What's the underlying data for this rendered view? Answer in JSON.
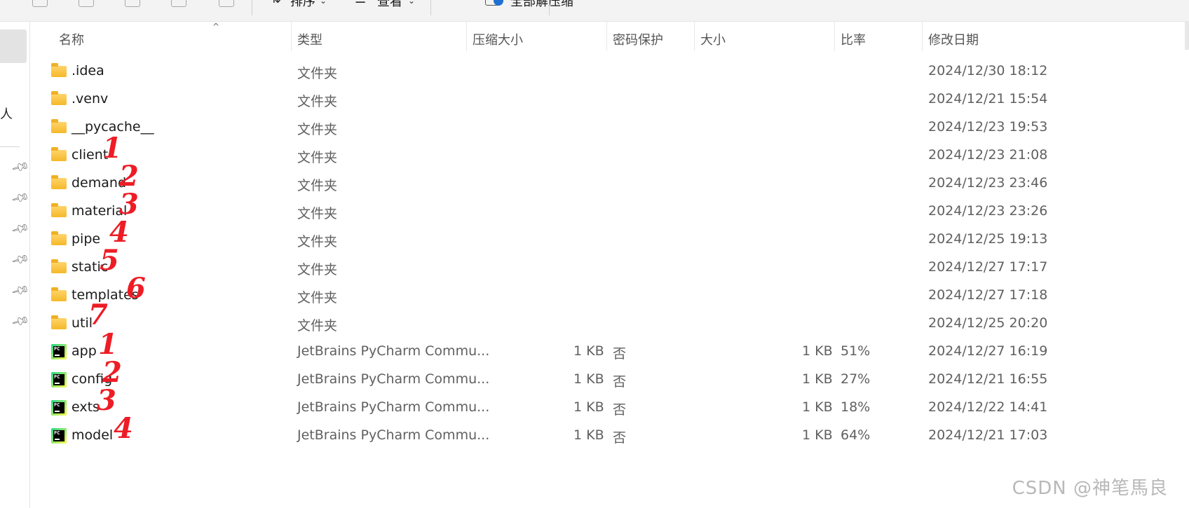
{
  "toolbar": {
    "sort_label": "排序",
    "view_label": "查看",
    "extract_all_label": "全部解压缩",
    "more_label": "⋯"
  },
  "nav": {
    "partial_glyph": "人"
  },
  "columns": {
    "name": "名称",
    "type": "类型",
    "compressed_size": "压缩大小",
    "password": "密码保护",
    "size": "大小",
    "ratio": "比率",
    "modified": "修改日期"
  },
  "rows": [
    {
      "name": ".idea",
      "type": "文件夹",
      "compressed": "",
      "password": "",
      "size": "",
      "ratio": "",
      "modified": "2024/12/30 18:12",
      "icon": "folder-icon"
    },
    {
      "name": ".venv",
      "type": "文件夹",
      "compressed": "",
      "password": "",
      "size": "",
      "ratio": "",
      "modified": "2024/12/21 15:54",
      "icon": "folder-icon"
    },
    {
      "name": "__pycache__",
      "type": "文件夹",
      "compressed": "",
      "password": "",
      "size": "",
      "ratio": "",
      "modified": "2024/12/23 19:53",
      "icon": "folder-icon"
    },
    {
      "name": "client",
      "type": "文件夹",
      "compressed": "",
      "password": "",
      "size": "",
      "ratio": "",
      "modified": "2024/12/23 21:08",
      "icon": "folder-icon",
      "annotation": "1"
    },
    {
      "name": "demand",
      "type": "文件夹",
      "compressed": "",
      "password": "",
      "size": "",
      "ratio": "",
      "modified": "2024/12/23 23:46",
      "icon": "folder-icon",
      "annotation": "2"
    },
    {
      "name": "material",
      "type": "文件夹",
      "compressed": "",
      "password": "",
      "size": "",
      "ratio": "",
      "modified": "2024/12/23 23:26",
      "icon": "folder-icon",
      "annotation": "3"
    },
    {
      "name": "pipe",
      "type": "文件夹",
      "compressed": "",
      "password": "",
      "size": "",
      "ratio": "",
      "modified": "2024/12/25 19:13",
      "icon": "folder-icon",
      "annotation": "4"
    },
    {
      "name": "static",
      "type": "文件夹",
      "compressed": "",
      "password": "",
      "size": "",
      "ratio": "",
      "modified": "2024/12/27 17:17",
      "icon": "folder-icon",
      "annotation": "5"
    },
    {
      "name": "templates",
      "type": "文件夹",
      "compressed": "",
      "password": "",
      "size": "",
      "ratio": "",
      "modified": "2024/12/27 17:18",
      "icon": "folder-icon",
      "annotation": "6"
    },
    {
      "name": "util",
      "type": "文件夹",
      "compressed": "",
      "password": "",
      "size": "",
      "ratio": "",
      "modified": "2024/12/25 20:20",
      "icon": "folder-icon",
      "annotation": "7"
    },
    {
      "name": "app",
      "type": "JetBrains PyCharm Commu...",
      "compressed": "1 KB",
      "password": "否",
      "size": "1 KB",
      "ratio": "51%",
      "modified": "2024/12/27 16:19",
      "icon": "pycharm-icon",
      "annotation": "1"
    },
    {
      "name": "config",
      "type": "JetBrains PyCharm Commu...",
      "compressed": "1 KB",
      "password": "否",
      "size": "1 KB",
      "ratio": "27%",
      "modified": "2024/12/21 16:55",
      "icon": "pycharm-icon",
      "annotation": "2"
    },
    {
      "name": "exts",
      "type": "JetBrains PyCharm Commu...",
      "compressed": "1 KB",
      "password": "否",
      "size": "1 KB",
      "ratio": "18%",
      "modified": "2024/12/22 14:41",
      "icon": "pycharm-icon",
      "annotation": "3"
    },
    {
      "name": "model",
      "type": "JetBrains PyCharm Commu...",
      "compressed": "1 KB",
      "password": "否",
      "size": "1 KB",
      "ratio": "64%",
      "modified": "2024/12/21 17:03",
      "icon": "pycharm-icon",
      "annotation": "4"
    }
  ],
  "watermark": "CSDN @神笔馬良",
  "colors": {
    "annotation": "#ee1c25",
    "folder": "#f5b92a",
    "header_text": "#555555"
  }
}
